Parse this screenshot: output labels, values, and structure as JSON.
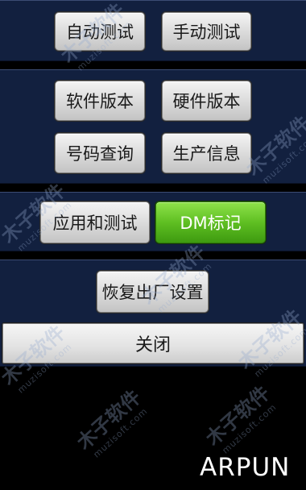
{
  "buttons": {
    "auto_test": "自动测试",
    "manual_test": "手动测试",
    "software_version": "软件版本",
    "hardware_version": "硬件版本",
    "number_query": "号码查询",
    "production_info": "生产信息",
    "apps_and_test": "应用和测试",
    "dm_mark": "DM标记",
    "factory_reset": "恢复出厂设置",
    "close": "关闭"
  },
  "watermark": {
    "text": "木子软件",
    "domain": "muzisoft.com",
    "brand": "ARPUN"
  },
  "colors": {
    "panel_bg": "#12203f",
    "screen_bg": "#000000",
    "accent_green": "#5fbf22"
  }
}
